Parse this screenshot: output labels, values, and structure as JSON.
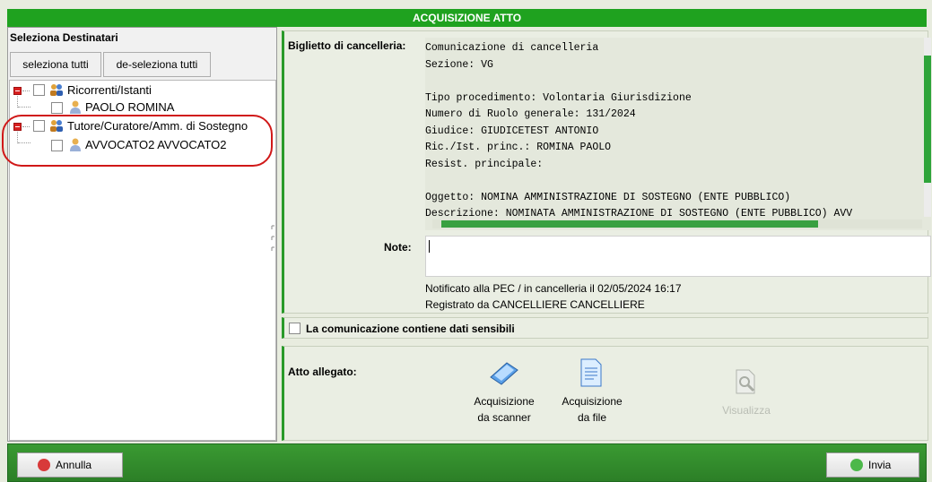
{
  "window": {
    "title": "ACQUISIZIONE ATTO"
  },
  "left": {
    "heading": "Seleziona Destinatari",
    "select_all": "seleziona tutti",
    "deselect_all": "de-seleziona tutti",
    "tree": [
      {
        "group": "Ricorrenti/Istanti",
        "items": [
          "PAOLO ROMINA"
        ]
      },
      {
        "group": "Tutore/Curatore/Amm. di Sostegno",
        "items": [
          "AVVOCATO2 AVVOCATO2"
        ]
      }
    ]
  },
  "right": {
    "biglietto_label": "Biglietto di cancelleria:",
    "biglietto_lines": [
      "Comunicazione di cancelleria",
      "Sezione: VG",
      "",
      "Tipo procedimento: Volontaria Giurisdizione",
      "Numero di Ruolo generale: 131/2024",
      "Giudice: GIUDICETEST ANTONIO",
      "Ric./Ist. princ.: ROMINA PAOLO",
      "Resist. principale:",
      "",
      "Oggetto: NOMINA AMMINISTRAZIONE DI SOSTEGNO (ENTE PUBBLICO)",
      "Descrizione: NOMINATA AMMINISTRAZIONE DI SOSTEGNO (ENTE PUBBLICO) AVV"
    ],
    "note_label": "Note:",
    "note_value": "",
    "notified": "Notificato alla PEC / in cancelleria il 02/05/2024 16:17",
    "registered": "Registrato da CANCELLIERE CANCELLIERE",
    "sensitive_label": "La comunicazione contiene dati sensibili",
    "attachment_label": "Atto allegato:",
    "scan_line1": "Acquisizione",
    "scan_line2": "da scanner",
    "file_line1": "Acquisizione",
    "file_line2": "da file",
    "view_label": "Visualizza"
  },
  "footer": {
    "cancel": "Annulla",
    "send": "Invia"
  },
  "colors": {
    "title_bg": "#1fa21f",
    "footer_bg": "#2c7f27",
    "highlight": "#d01818"
  }
}
